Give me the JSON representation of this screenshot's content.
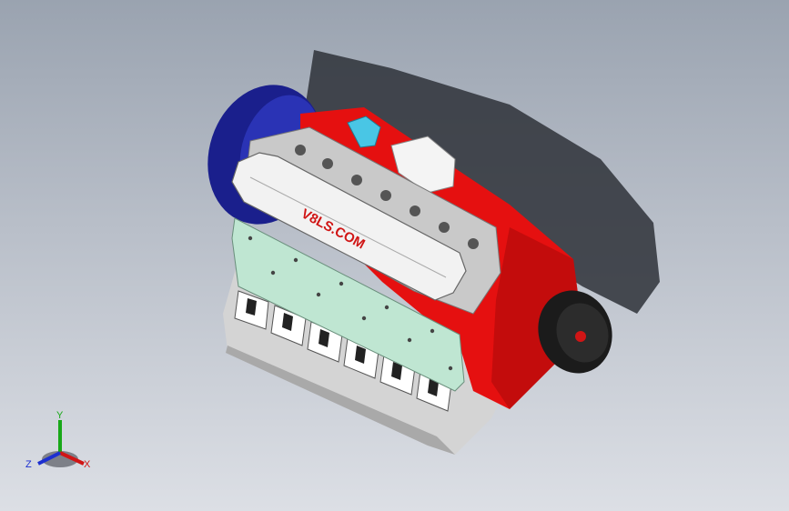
{
  "viewport": {
    "background_top": "#9aa3b0",
    "background_bottom": "#dcdfe5"
  },
  "model": {
    "engraving_text": "V8LS.COM",
    "colors": {
      "block": "#e51010",
      "block_dark": "#a80a0a",
      "bellhousing": "#1a1f8c",
      "valve_cover": "#f2f2f2",
      "head": "#c9c9c9",
      "side_cover": "#bfe6d2",
      "oil_pan": "#d4d4d4",
      "pulley": "#1b1b1b",
      "shadow": "#2e3138",
      "oil_cap": "#49c6e5",
      "alternator": "#f4f4f4"
    }
  },
  "triad": {
    "x_label": "X",
    "y_label": "Y",
    "z_label": "Z",
    "x_color": "#d01515",
    "y_color": "#18a818",
    "z_color": "#1c2fd0"
  }
}
